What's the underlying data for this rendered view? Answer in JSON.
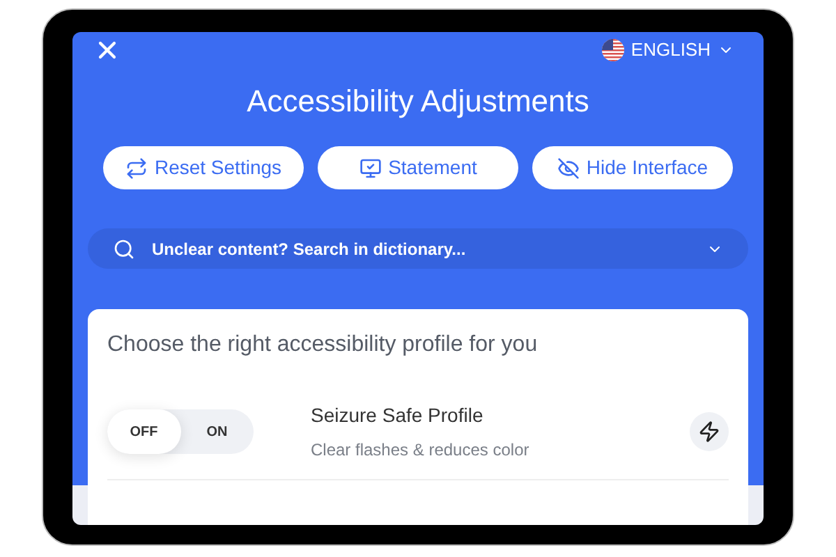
{
  "language": {
    "label": "ENGLISH"
  },
  "title": "Accessibility Adjustments",
  "actions": [
    {
      "kind": "reset",
      "label": "Reset Settings"
    },
    {
      "kind": "statement",
      "label": "Statement"
    },
    {
      "kind": "hide",
      "label": "Hide Interface"
    }
  ],
  "search": {
    "placeholder": "Unclear content? Search in dictionary..."
  },
  "profiles_card": {
    "heading": "Choose the right accessibility profile for you",
    "profiles": [
      {
        "name": "Seizure Safe Profile",
        "description": "Clear flashes & reduces color",
        "toggle": [
          {
            "label": "OFF",
            "selected": true
          },
          {
            "label": "ON",
            "selected": false
          }
        ]
      }
    ]
  }
}
